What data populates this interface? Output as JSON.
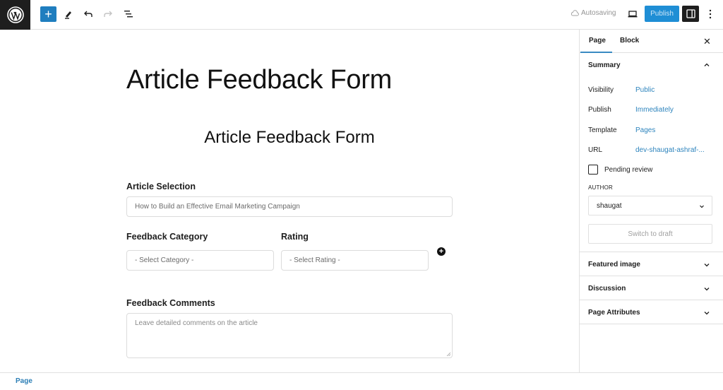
{
  "toolbar": {
    "logo": "wordpress-logo",
    "add_block": "+",
    "autosave_status": "Autosaving",
    "publish_label": "Publish",
    "colors": {
      "accent": "#1f8ed5",
      "dark": "#1e1e1e"
    }
  },
  "editor": {
    "page_title": "Article Feedback Form",
    "form_heading": "Article Feedback Form",
    "fields": {
      "article_selection": {
        "label": "Article Selection",
        "value": "How to Build an Effective Email Marketing Campaign"
      },
      "feedback_category": {
        "label": "Feedback Category",
        "value": "- Select Category -"
      },
      "rating": {
        "label": "Rating",
        "value": "- Select Rating -"
      },
      "feedback_comments": {
        "label": "Feedback Comments",
        "placeholder": "Leave detailed comments on the article"
      }
    }
  },
  "sidebar": {
    "tabs": [
      {
        "label": "Page",
        "active": true
      },
      {
        "label": "Block",
        "active": false
      }
    ],
    "summary": {
      "title": "Summary",
      "rows": [
        {
          "label": "Visibility",
          "value": "Public"
        },
        {
          "label": "Publish",
          "value": "Immediately"
        },
        {
          "label": "Template",
          "value": "Pages"
        },
        {
          "label": "URL",
          "value": "dev-shaugat-ashraf-..."
        }
      ],
      "pending_review_label": "Pending review",
      "pending_review_checked": false,
      "author_label": "AUTHOR",
      "author_value": "shaugat",
      "switch_draft_label": "Switch to draft"
    },
    "panels": [
      {
        "title": "Featured image"
      },
      {
        "title": "Discussion"
      },
      {
        "title": "Page Attributes"
      }
    ]
  },
  "footer": {
    "breadcrumb": "Page"
  }
}
